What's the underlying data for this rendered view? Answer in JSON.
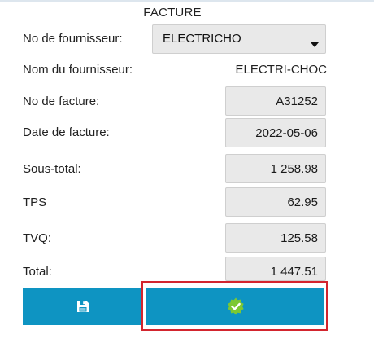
{
  "form": {
    "title": "FACTURE",
    "supplier_no": {
      "label": "No de fournisseur:",
      "selected": "ELECTRICHO"
    },
    "supplier_name": {
      "label": "Nom du fournisseur:",
      "value": "ELECTRI-CHOC"
    },
    "fields": [
      {
        "label": "No de facture:",
        "value": "A31252"
      },
      {
        "label": "Date de facture:",
        "value": "2022-05-06"
      },
      {
        "label": "Sous-total:",
        "value": "1 258.98"
      },
      {
        "label": "TPS",
        "value": "62.95"
      },
      {
        "label": "TVQ:",
        "value": "125.58"
      },
      {
        "label": "Total:",
        "value": "1 447.51"
      }
    ]
  },
  "actions": {
    "save_icon": "floppy-disk-icon",
    "confirm_icon": "checkmark-badge-icon"
  },
  "colors": {
    "button_bg": "#0e94c2",
    "field_bg": "#e9e9e9",
    "badge_green": "#7cc832",
    "highlight_border": "#d3252e"
  }
}
